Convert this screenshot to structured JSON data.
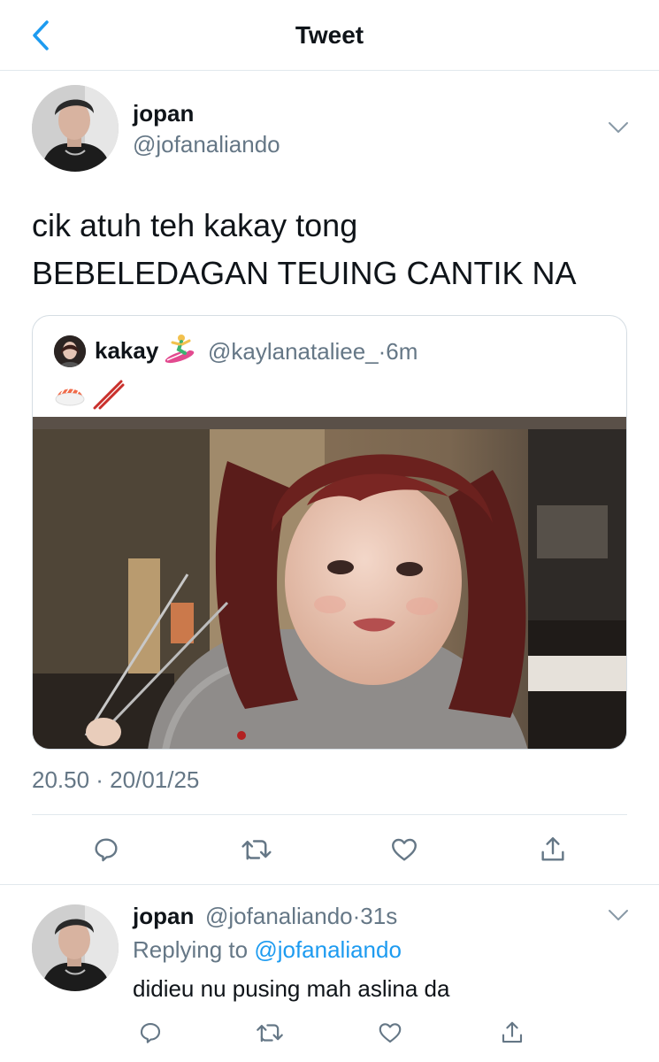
{
  "header": {
    "title": "Tweet",
    "back_icon": "chevron-left-icon",
    "accent_color": "#1d9bf0"
  },
  "tweet": {
    "author_name": "jopan",
    "author_handle": "@jofanaliando",
    "text_lines": [
      "cik atuh teh kakay tong",
      "BEBELEDAGAN TEUING CANTIK NA"
    ],
    "timestamp": "20.50 · 20/01/25",
    "quoted": {
      "author_name": "kakay",
      "name_emoji": "surfer-emoji",
      "handle_time": "@kaylanataliee_·6m",
      "body_emojis": "sushi-chopsticks-emoji",
      "photo": "woman-with-chopsticks-photo"
    }
  },
  "actions": [
    "reply-icon",
    "retweet-icon",
    "like-icon",
    "share-icon"
  ],
  "reply": {
    "author_name": "jopan",
    "handle_time": "@jofanaliando·31s",
    "replying_prefix": "Replying to",
    "replying_mention": "@jofanaliando",
    "text": "didieu nu pusing mah aslina da"
  }
}
